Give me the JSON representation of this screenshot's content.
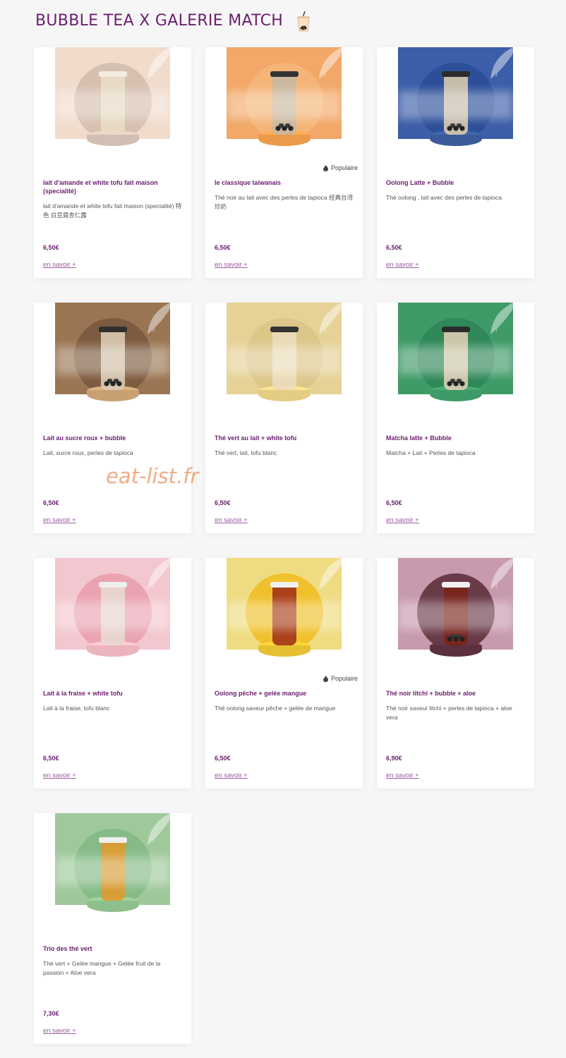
{
  "page": {
    "title": "BUBBLE TEA X GALERIE MATCH",
    "title_icon": "bubble-tea-cup-icon",
    "accent_color": "#6b1f6f"
  },
  "watermark": "eat-list.fr",
  "more_label": "en savoir +",
  "items": [
    {
      "name": "lait d'amande et white tofu fait maison (specialité)",
      "description": "lait d'amande et white tofu fait maison (specialité) 特色 白豆腐杏仁露",
      "price": "6,50€",
      "badge": "",
      "panel": "#f1dccc",
      "circle": "#d6c0b0",
      "cup": "#e9dcc4",
      "lid": "#f3ece2",
      "pedestal": "#d2bfb3",
      "pearls": false
    },
    {
      "name": "le classique taiwanais",
      "description": "Thé noir au lait avec des perles de tapioca 经典台湾珍奶",
      "price": "6,50€",
      "badge": "Populaire",
      "panel": "#f2a868",
      "circle": "#f5b578",
      "cup": "#c8b8a2",
      "lid": "#333333",
      "pedestal": "#e99a4a",
      "pearls": true
    },
    {
      "name": "Oolong Latte + Bubble",
      "description": "Thé oolong , lait avec des perles de tapioca",
      "price": "6,50€",
      "badge": "",
      "panel": "#3b5ea8",
      "circle": "#2c4f9a",
      "cup": "#d8c7ae",
      "lid": "#2b2b2b",
      "pedestal": "#3a5a9a",
      "pearls": true
    },
    {
      "name": "Lait au sucre roux + bubble",
      "description": "Lait, sucre roux, perles de tapioca",
      "price": "6,50€",
      "badge": "",
      "panel": "#9a7553",
      "circle": "#7d5b40",
      "cup": "#d9c9b1",
      "lid": "#2f2f2f",
      "pedestal": "#c9a074",
      "pearls": true
    },
    {
      "name": "Thé vert au lait + white tofu",
      "description": "Thé vert, lait, tofu blanc",
      "price": "6,50€",
      "badge": "",
      "panel": "#e6d296",
      "circle": "#dcc789",
      "cup": "#ecdcbd",
      "lid": "#333333",
      "pedestal": "#e4cc82",
      "pearls": false
    },
    {
      "name": "Matcha latte + Bubble",
      "description": "Matcha + Lait + Perles de tapioca",
      "price": "6,50€",
      "badge": "",
      "panel": "#3e9a66",
      "circle": "#2f8858",
      "cup": "#dbccb2",
      "lid": "#2b2b2b",
      "pedestal": "#3e9a66",
      "pearls": true
    },
    {
      "name": "Lait à la fraise + white tofu",
      "description": "Lait à la fraise, tofu blanc",
      "price": "6,50€",
      "badge": "",
      "panel": "#f3c7cf",
      "circle": "#eaa3b1",
      "cup": "#e8d8d0",
      "lid": "#eeeeee",
      "pedestal": "#ecb4bd",
      "pearls": false
    },
    {
      "name": "Oolong pêche + gelée mangue",
      "description": "Thé oolong saveur pêche + gelée de mangue",
      "price": "6,50€",
      "badge": "Populaire",
      "panel": "#efdc82",
      "circle": "#f0c12c",
      "cup": "#a2331a",
      "lid": "#f0f0f0",
      "pedestal": "#e4c032",
      "pearls": false
    },
    {
      "name": "Thé noir litchi + bubble + aloe",
      "description": "Thé noir saveur litchi + perles de tapioca + aloe vera",
      "price": "6,90€",
      "badge": "",
      "panel": "#c79aae",
      "circle": "#6a3a48",
      "cup": "#7a2418",
      "lid": "#f0f0f0",
      "pedestal": "#5c3040",
      "pearls": true
    },
    {
      "name": "Trio des thé vert",
      "description": "Thé vert + Gelée mangue + Gelée fruit de la passion + Aloe vera",
      "price": "7,30€",
      "badge": "",
      "panel": "#9fc99c",
      "circle": "#86bb88",
      "cup": "#e09a2e",
      "lid": "#f0f0f0",
      "pedestal": "#8fbf8c",
      "pearls": false
    }
  ]
}
